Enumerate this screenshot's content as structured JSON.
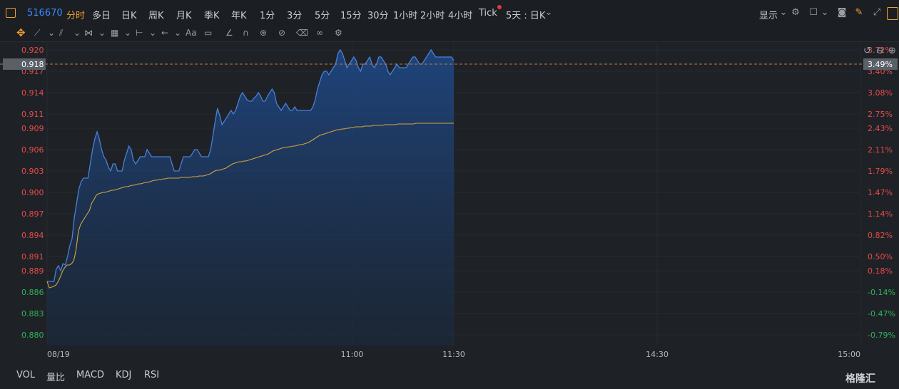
{
  "header": {
    "symbol": "516670",
    "periods": [
      "分时",
      "多日",
      "日K",
      "周K",
      "月K",
      "季K",
      "年K",
      "1分",
      "3分",
      "5分",
      "15分",
      "30分",
      "1小时",
      "2小时",
      "4小时",
      "Tick"
    ],
    "multi_day": "5天 : 日K",
    "display_label": "显示"
  },
  "toolbar2": {
    "text_tool": "Aa"
  },
  "indicators": [
    "VOL",
    "量比",
    "MACD",
    "KDJ",
    "RSI"
  ],
  "brand": "格隆汇",
  "colors": {
    "up": "#e84a4a",
    "down": "#2fb35a",
    "price_line": "#4a7fd6",
    "avg_line": "#d9a43c",
    "dashed": "#c07a45"
  },
  "chart_data": {
    "type": "line",
    "title": "",
    "xlabel": "",
    "ylabel": "",
    "prev_close": 0.8874,
    "ylim": [
      0.8785,
      0.9212
    ],
    "yticks": [
      "0.920",
      "0.917",
      "0.914",
      "0.911",
      "0.909",
      "0.906",
      "0.903",
      "0.900",
      "0.897",
      "0.894",
      "0.891",
      "0.889",
      "0.886",
      "0.883",
      "0.880"
    ],
    "ytick_values": [
      0.92,
      0.917,
      0.914,
      0.911,
      0.909,
      0.906,
      0.903,
      0.9,
      0.897,
      0.894,
      0.891,
      0.889,
      0.886,
      0.883,
      0.88
    ],
    "pct_ticks": [
      "3.72%",
      "3.40%",
      "3.08%",
      "2.75%",
      "2.43%",
      "2.11%",
      "1.79%",
      "1.47%",
      "1.14%",
      "0.82%",
      "0.50%",
      "0.18%",
      "-0.14%",
      "-0.47%",
      "-0.79%"
    ],
    "xticks": [
      {
        "label": "08/19",
        "minute": 0
      },
      {
        "label": "11:00",
        "minute": 90
      },
      {
        "label": "11:30",
        "minute": 120
      },
      {
        "label": "14:30",
        "minute": 180
      },
      {
        "label": "15:00",
        "minute": 240
      }
    ],
    "current_price": "0.918",
    "current_pct": "3.49%",
    "series": [
      {
        "values": [
          0.8875,
          0.8875,
          0.8875,
          0.8875,
          0.8892,
          0.8897,
          0.889,
          0.89,
          0.8898,
          0.891,
          0.8925,
          0.8935,
          0.8965,
          0.8985,
          0.9005,
          0.9015,
          0.902,
          0.902,
          0.902,
          0.904,
          0.906,
          0.9075,
          0.9085,
          0.9075,
          0.906,
          0.905,
          0.9045,
          0.9035,
          0.903,
          0.904,
          0.904,
          0.903,
          0.903,
          0.903,
          0.9045,
          0.9055,
          0.9065,
          0.906,
          0.9045,
          0.904,
          0.9045,
          0.905,
          0.905,
          0.905,
          0.906,
          0.9055,
          0.905,
          0.905,
          0.905,
          0.905,
          0.905,
          0.905,
          0.905,
          0.905,
          0.905,
          0.904,
          0.903,
          0.903,
          0.903,
          0.904,
          0.905,
          0.905,
          0.905,
          0.905,
          0.9055,
          0.906,
          0.906,
          0.9055,
          0.905,
          0.905,
          0.905,
          0.905,
          0.906,
          0.908,
          0.91,
          0.9118,
          0.9108,
          0.9095,
          0.91,
          0.9105,
          0.911,
          0.9115,
          0.911,
          0.9115,
          0.9125,
          0.9135,
          0.914,
          0.9135,
          0.913,
          0.9128,
          0.9128,
          0.9132,
          0.9135,
          0.914,
          0.9135,
          0.9128,
          0.9128,
          0.9135,
          0.914,
          0.9145,
          0.914,
          0.9125,
          0.912,
          0.9115,
          0.912,
          0.9125,
          0.912,
          0.9115,
          0.9115,
          0.912,
          0.9115,
          0.9115,
          0.9115,
          0.9115,
          0.9115,
          0.9115,
          0.9115,
          0.912,
          0.913,
          0.9145,
          0.9155,
          0.9165,
          0.917,
          0.917,
          0.9165,
          0.917,
          0.9175,
          0.918,
          0.9195,
          0.92,
          0.9195,
          0.9185,
          0.9175,
          0.918,
          0.9185,
          0.919,
          0.9185,
          0.9175,
          0.917,
          0.918,
          0.918,
          0.9185,
          0.919,
          0.918,
          0.9175,
          0.918,
          0.919,
          0.919,
          0.9185,
          0.918,
          0.917,
          0.9165,
          0.917,
          0.9175,
          0.918,
          0.9175,
          0.9175,
          0.9175,
          0.9175,
          0.918,
          0.9185,
          0.919,
          0.919,
          0.9185,
          0.918,
          0.918,
          0.9185,
          0.919,
          0.9195,
          0.92,
          0.9195,
          0.919,
          0.919,
          0.919,
          0.919,
          0.919,
          0.919,
          0.919,
          0.919,
          0.9185
        ]
      },
      {
        "values": [
          0.8875,
          0.8866,
          0.8867,
          0.8868,
          0.887,
          0.8875,
          0.8882,
          0.889,
          0.8895,
          0.8898,
          0.8898,
          0.89,
          0.8905,
          0.892,
          0.8945,
          0.8955,
          0.896,
          0.8965,
          0.897,
          0.8975,
          0.8985,
          0.899,
          0.8996,
          0.8998,
          0.8999,
          0.9,
          0.9,
          0.9001,
          0.9002,
          0.9003,
          0.9003,
          0.9004,
          0.9005,
          0.9006,
          0.9007,
          0.9008,
          0.9008,
          0.9009,
          0.901,
          0.901,
          0.9011,
          0.9012,
          0.9012,
          0.9013,
          0.9014,
          0.9014,
          0.9015,
          0.9016,
          0.9017,
          0.9017,
          0.9018,
          0.9018,
          0.9019,
          0.9019,
          0.902,
          0.902,
          0.902,
          0.902,
          0.902,
          0.902,
          0.9021,
          0.9021,
          0.9021,
          0.9021,
          0.9021,
          0.9022,
          0.9022,
          0.9022,
          0.9023,
          0.9023,
          0.9023,
          0.9024,
          0.9025,
          0.9026,
          0.9028,
          0.903,
          0.9031,
          0.9031,
          0.9032,
          0.9033,
          0.9034,
          0.9036,
          0.9038,
          0.904,
          0.9041,
          0.9042,
          0.9043,
          0.9043,
          0.9044,
          0.9044,
          0.9045,
          0.9046,
          0.9047,
          0.9048,
          0.9049,
          0.905,
          0.9051,
          0.9052,
          0.9053,
          0.9054,
          0.9056,
          0.9058,
          0.9059,
          0.906,
          0.9061,
          0.9062,
          0.9063,
          0.9063,
          0.9064,
          0.9064,
          0.9065,
          0.9065,
          0.9066,
          0.9067,
          0.9067,
          0.9068,
          0.9069,
          0.907,
          0.9072,
          0.9074,
          0.9076,
          0.9078,
          0.908,
          0.9081,
          0.9082,
          0.9083,
          0.9084,
          0.9085,
          0.9086,
          0.9087,
          0.9088,
          0.9088,
          0.9089,
          0.9089,
          0.909,
          0.909,
          0.9091,
          0.9091,
          0.9092,
          0.9092,
          0.9092,
          0.9092,
          0.9093,
          0.9093,
          0.9093,
          0.9093,
          0.9094,
          0.9094,
          0.9094,
          0.9094,
          0.9094,
          0.9095,
          0.9095,
          0.9095,
          0.9095,
          0.9095,
          0.9095,
          0.9096,
          0.9096,
          0.9096,
          0.9096,
          0.9096,
          0.9096,
          0.9096,
          0.9096,
          0.9097,
          0.9097,
          0.9097,
          0.9097,
          0.9097,
          0.9097,
          0.9097,
          0.9097,
          0.9097,
          0.9097,
          0.9097,
          0.9097,
          0.9097,
          0.9097,
          0.9097,
          0.9097,
          0.9097,
          0.9097
        ]
      }
    ]
  }
}
